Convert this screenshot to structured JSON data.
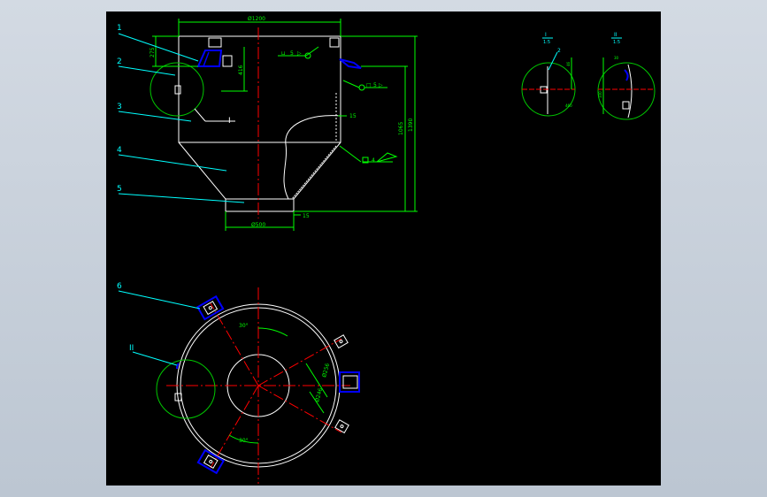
{
  "colors": {
    "background": "#000000",
    "frame": "#c4cdd8",
    "outline": "#ffffff",
    "dimension": "#00ff00",
    "leader": "#00ffff",
    "centerline": "#ff0000",
    "detail_circle": "#00c800",
    "part": "#0000ff"
  },
  "part_labels": [
    "1",
    "2",
    "3",
    "4",
    "5",
    "6"
  ],
  "detail_labels": {
    "detail_1": "I",
    "detail_2": "II",
    "view_1_a": "I",
    "view_1_b": "1:5",
    "view_2_a": "II",
    "view_2_b": "1:5"
  },
  "dimensions": {
    "top_diameter": "Ø1200",
    "outlet_diameter": "Ø500",
    "bracket_height": "275",
    "bracket_offset": "416",
    "overall_height": "1390",
    "cone_height": "1065",
    "thickness_1": "15",
    "thickness_2": "15",
    "angle_top": "30°",
    "angle_bottom": "30°",
    "bolt_circle_1": "Ø256",
    "bolt_circle_2": "Ø246"
  },
  "weld_symbols": {
    "weld_1": "5",
    "weld_2": "5",
    "weld_3": "4"
  },
  "detail_view_dims": {
    "d1": "46",
    "d2": "100",
    "d3": "30",
    "d4": "460"
  }
}
